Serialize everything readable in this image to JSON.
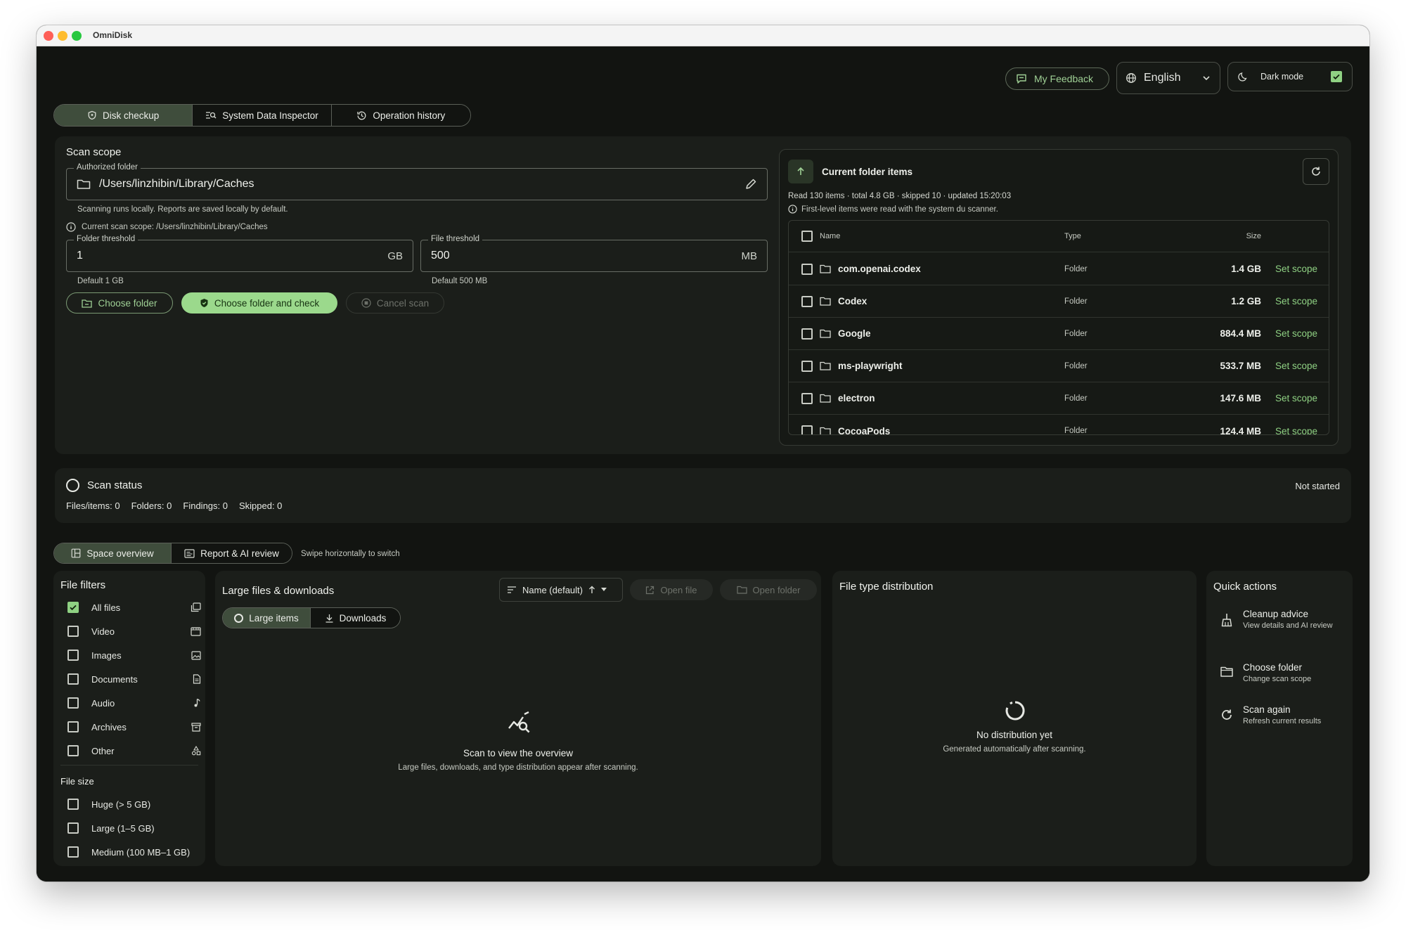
{
  "window": {
    "title": "OmniDisk"
  },
  "header": {
    "feedback_label": "My Feedback",
    "language": "English",
    "dark_mode_label": "Dark mode",
    "dark_mode_on": true
  },
  "main_tabs": [
    {
      "label": "Disk checkup",
      "active": true
    },
    {
      "label": "System Data Inspector",
      "active": false
    },
    {
      "label": "Operation history",
      "active": false
    }
  ],
  "scan_scope": {
    "title": "Scan scope",
    "authorized_folder_label": "Authorized folder",
    "authorized_folder_value": "/Users/linzhibin/Library/Caches",
    "local_note": "Scanning runs locally. Reports are saved locally by default.",
    "current_scope": "Current scan scope: /Users/linzhibin/Library/Caches",
    "folder_threshold_label": "Folder threshold",
    "folder_threshold_value": "1",
    "folder_threshold_unit": "GB",
    "folder_threshold_default": "Default 1 GB",
    "file_threshold_label": "File threshold",
    "file_threshold_value": "500",
    "file_threshold_unit": "MB",
    "file_threshold_default": "Default 500 MB",
    "choose_folder": "Choose folder",
    "choose_and_check": "Choose folder and check",
    "cancel_scan": "Cancel scan"
  },
  "current_folder": {
    "title": "Current folder items",
    "summary": "Read 130 items · total 4.8 GB · skipped 10 · updated 15:20:03",
    "note": "First-level items were read with the system du scanner.",
    "columns": {
      "name": "Name",
      "type": "Type",
      "size": "Size"
    },
    "rows": [
      {
        "name": "com.openai.codex",
        "type": "Folder",
        "size": "1.4 GB",
        "action": "Set scope"
      },
      {
        "name": "Codex",
        "type": "Folder",
        "size": "1.2 GB",
        "action": "Set scope"
      },
      {
        "name": "Google",
        "type": "Folder",
        "size": "884.4 MB",
        "action": "Set scope"
      },
      {
        "name": "ms-playwright",
        "type": "Folder",
        "size": "533.7 MB",
        "action": "Set scope"
      },
      {
        "name": "electron",
        "type": "Folder",
        "size": "147.6 MB",
        "action": "Set scope"
      },
      {
        "name": "CocoaPods",
        "type": "Folder",
        "size": "124.4 MB",
        "action": "Set scope"
      }
    ]
  },
  "scan_status": {
    "title": "Scan status",
    "state": "Not started",
    "files_items": "Files/items: 0",
    "folders": "Folders: 0",
    "findings": "Findings: 0",
    "skipped": "Skipped: 0"
  },
  "view_tabs": [
    {
      "label": "Space overview",
      "active": true
    },
    {
      "label": "Report & AI review",
      "active": false
    }
  ],
  "swipe_hint": "Swipe horizontally to switch",
  "file_filters": {
    "title": "File filters",
    "items": [
      {
        "label": "All files",
        "checked": true,
        "icon": "stack-icon"
      },
      {
        "label": "Video",
        "checked": false,
        "icon": "video-icon"
      },
      {
        "label": "Images",
        "checked": false,
        "icon": "image-icon"
      },
      {
        "label": "Documents",
        "checked": false,
        "icon": "document-icon"
      },
      {
        "label": "Audio",
        "checked": false,
        "icon": "music-note-icon"
      },
      {
        "label": "Archives",
        "checked": false,
        "icon": "archive-icon"
      },
      {
        "label": "Other",
        "checked": false,
        "icon": "shapes-icon"
      }
    ],
    "size_title": "File size",
    "sizes": [
      {
        "label": "Huge (> 5 GB)",
        "checked": false
      },
      {
        "label": "Large (1–5 GB)",
        "checked": false
      },
      {
        "label": "Medium (100 MB–1 GB)",
        "checked": false
      }
    ]
  },
  "large_files": {
    "title": "Large files & downloads",
    "sort_label": "Name (default)",
    "open_file": "Open file",
    "open_folder": "Open folder",
    "tabs": [
      {
        "label": "Large items",
        "active": true
      },
      {
        "label": "Downloads",
        "active": false
      }
    ],
    "empty_title": "Scan to view the overview",
    "empty_desc": "Large files, downloads, and type distribution appear after scanning."
  },
  "distribution": {
    "title": "File type distribution",
    "empty_title": "No distribution yet",
    "empty_desc": "Generated automatically after scanning."
  },
  "quick_actions": {
    "title": "Quick actions",
    "items": [
      {
        "title": "Cleanup advice",
        "desc": "View details and AI review"
      },
      {
        "title": "Choose folder",
        "desc": "Change scan scope"
      },
      {
        "title": "Scan again",
        "desc": "Refresh current results"
      }
    ]
  },
  "colors": {
    "accent": "#8fd183",
    "background": "#121411",
    "panel": "#1b1e1a"
  }
}
